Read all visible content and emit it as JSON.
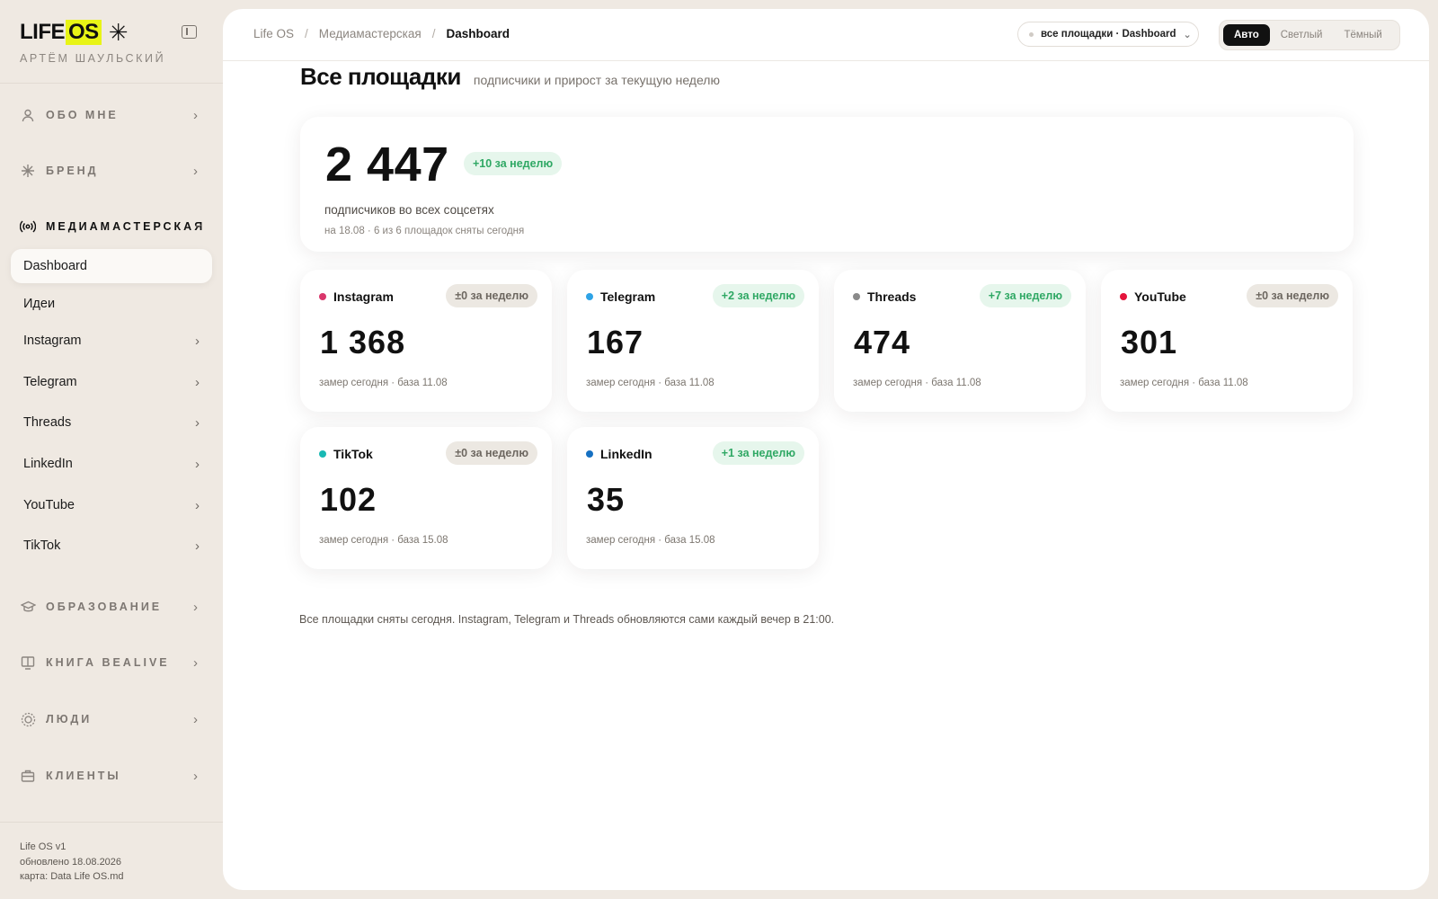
{
  "app": {
    "logo_pre": "LIFE",
    "logo_hl": "OS",
    "logo_star": "✳",
    "owner": "АРТЁМ ШАУЛЬСКИЙ"
  },
  "sidebar": {
    "sections": [
      {
        "label": "ОБО МНЕ",
        "icon": "user-icon"
      },
      {
        "label": "БРЕНД",
        "icon": "asterisk-icon"
      },
      {
        "label": "МЕДИАМАСТЕРСКАЯ",
        "icon": "broadcast-icon"
      },
      {
        "label": "ОБРАЗОВАНИЕ",
        "icon": "graduation-cap-icon"
      },
      {
        "label": "КНИГА BEALIVE",
        "icon": "book-icon"
      },
      {
        "label": "ЛЮДИ",
        "icon": "people-icon"
      },
      {
        "label": "КЛИЕНТЫ",
        "icon": "briefcase-icon"
      }
    ],
    "media_items": [
      {
        "label": "Dashboard"
      },
      {
        "label": "Идеи"
      },
      {
        "label": "Instagram"
      },
      {
        "label": "Telegram"
      },
      {
        "label": "Threads"
      },
      {
        "label": "LinkedIn"
      },
      {
        "label": "YouTube"
      },
      {
        "label": "TikTok"
      }
    ],
    "footer": {
      "version": "Life OS v1",
      "updated": "обновлено 18.08.2026",
      "map": "карта: Data Life OS.md"
    }
  },
  "breadcrumb": {
    "items": [
      "Life OS",
      "Медиамастерская",
      "Dashboard"
    ],
    "separator": "/"
  },
  "scope_selector": {
    "value": "все площадки · Dashboard"
  },
  "theme_switch": {
    "options": [
      "Авто",
      "Светлый",
      "Тёмный"
    ],
    "selected": "Авто"
  },
  "page": {
    "title": "Все площадки",
    "description": "подписчики и прирост за текущую неделю"
  },
  "total": {
    "value": "2 447",
    "delta": "+10 за неделю",
    "label": "подписчиков во всех соцсетях",
    "meta": "на 18.08 · 6 из 6 площадок сняты сегодня"
  },
  "platforms": [
    {
      "name": "Instagram",
      "value": "1 368",
      "delta": "±0 за неделю",
      "delta_kind": "zero",
      "meta": "замер сегодня · база 11.08",
      "color": "#d9366b"
    },
    {
      "name": "Telegram",
      "value": "167",
      "delta": "+2 за неделю",
      "delta_kind": "pos",
      "meta": "замер сегодня · база 11.08",
      "color": "#2ea3e6"
    },
    {
      "name": "Threads",
      "value": "474",
      "delta": "+7 за неделю",
      "delta_kind": "pos",
      "meta": "замер сегодня · база 11.08",
      "color": "#8a8a8a"
    },
    {
      "name": "YouTube",
      "value": "301",
      "delta": "±0 за неделю",
      "delta_kind": "zero",
      "meta": "замер сегодня · база 11.08",
      "color": "#e4143c"
    },
    {
      "name": "TikTok",
      "value": "102",
      "delta": "±0 за неделю",
      "delta_kind": "zero",
      "meta": "замер сегодня · база 15.08",
      "color": "#19b9b4"
    },
    {
      "name": "LinkedIn",
      "value": "35",
      "delta": "+1 за неделю",
      "delta_kind": "pos",
      "meta": "замер сегодня · база 15.08",
      "color": "#1670c2"
    }
  ],
  "footnote": "Все площадки сняты сегодня. Instagram, Telegram и Threads обновляются сами каждый вечер в 21:00."
}
